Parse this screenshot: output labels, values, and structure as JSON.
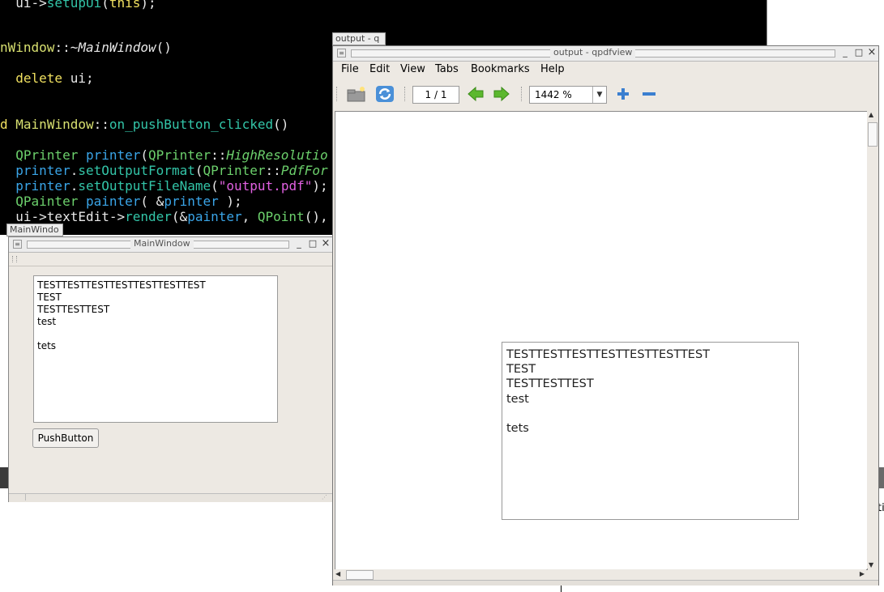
{
  "editor": {
    "lines": [
      {
        "pre": "  ",
        "a": "ui",
        "b": "->",
        "c": "setupUi",
        "d": "(",
        "e": "this",
        "f": ");"
      },
      {
        "text": "nWindow::~MainWindow()"
      },
      {
        "text": "  delete ui;"
      },
      {
        "text": "d MainWindow::on_pushButton_clicked()"
      },
      {
        "text": "  QPrinter printer(QPrinter::HighResolutio"
      },
      {
        "text": "  printer.setOutputFormat(QPrinter::PdfFor"
      },
      {
        "text": "  printer.setOutputFileName(\"output.pdf\");"
      },
      {
        "text": "  QPainter painter( &printer );"
      },
      {
        "text": "  ui->textEdit->render(&painter, QPoint(),"
      }
    ]
  },
  "taskbar": {
    "output_tab": "output - q",
    "mainwindow_tab": "MainWindo"
  },
  "mainwindow": {
    "title": "MainWindow",
    "textedit_lines": [
      "TESTTESTTESTTESTTESTTESTTEST",
      "TEST",
      "TESTTESTTEST",
      "test",
      "",
      "tets"
    ],
    "push_button": "PushButton"
  },
  "pdfview": {
    "title": "output - qpdfview",
    "menu": [
      "File",
      "Edit",
      "View",
      "Tabs",
      "Bookmarks",
      "Help"
    ],
    "page_indicator": "1 / 1",
    "zoom": "1442 %",
    "page_lines": [
      "TESTTESTTESTTESTTESTTESTTEST",
      "TEST",
      "TESTTESTTEST",
      "test",
      "",
      "tets"
    ]
  },
  "background": {
    "right_char": "ti"
  },
  "colors": {
    "accent_green": "#4caf20",
    "accent_blue": "#3b7fd0"
  }
}
